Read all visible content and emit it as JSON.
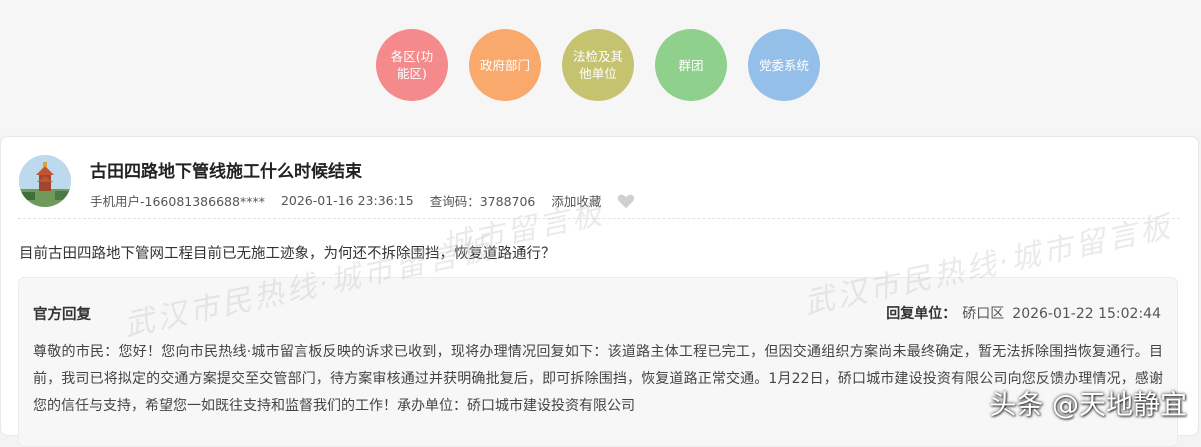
{
  "categories": [
    {
      "label": "各区(功\n能区)",
      "color": "#f58a8d"
    },
    {
      "label": "政府部门",
      "color": "#f9a96b"
    },
    {
      "label": "法检及其\n他单位",
      "color": "#c5c36f"
    },
    {
      "label": "群团",
      "color": "#8fd08d"
    },
    {
      "label": "党委系统",
      "color": "#93bfe8"
    }
  ],
  "post": {
    "title": "古田四路地下管线施工什么时候结束",
    "user": "手机用户-166081386688****",
    "datetime": "2026-01-16 23:36:15",
    "query_code": "查询码：3788706",
    "favorite_label": "添加收藏",
    "question": "目前古田四路地下管网工程目前已无施工迹象，为何还不拆除围挡，恢复道路通行？"
  },
  "reply": {
    "label": "官方回复",
    "unit_label": "回复单位：",
    "unit": "硚口区",
    "datetime": "2026-01-22 15:02:44",
    "body": "尊敬的市民：您好！您向市民热线·城市留言板反映的诉求已收到，现将办理情况回复如下：该道路主体工程已完工，但因交通组织方案尚未最终确定，暂无法拆除围挡恢复通行。目前，我司已将拟定的交通方案提交至交管部门，待方案审核通过并获明确批复后，即可拆除围挡，恢复道路正常交通。1月22日，硚口城市建设投资有限公司向您反馈办理情况，感谢您的信任与支持，希望您一如既往支持和监督我们的工作！承办单位：硚口城市建设投资有限公司"
  },
  "watermark": {
    "text_a": "武汉市民热线·城市留言板",
    "text_b": "城市留言板"
  },
  "overlay": {
    "source": "头条 @天地静宜"
  },
  "colors": {
    "heart": "#d0d0d0"
  }
}
